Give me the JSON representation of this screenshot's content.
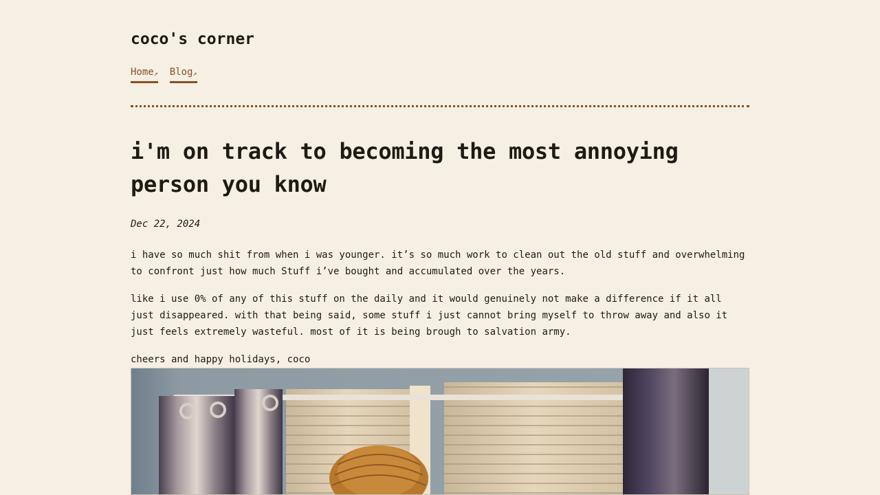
{
  "site": {
    "title": "coco's corner"
  },
  "nav": {
    "items": [
      {
        "label": "Home",
        "arrow": "↗"
      },
      {
        "label": "Blog",
        "arrow": "↗"
      }
    ]
  },
  "post": {
    "title": "i'm on track to becoming the most annoying person you know",
    "date": "Dec 22, 2024",
    "paragraphs": [
      "i have so much shit from when i was younger. it’s so much work to clean out the old stuff and overwhelming to confront just how much Stuff i’ve bought and accumulated over the years.",
      "like i use 0% of any of this stuff on the daily and it would genuinely not make a difference if it all just disappeared. with that being said, some stuff i just cannot bring myself to throw away and also it just feels extremely wasteful. most of it is being brough to salvation army.",
      "cheers and happy holidays, coco"
    ]
  },
  "colors": {
    "background": "#f6f0e4",
    "text": "#1f1a14",
    "accent": "#8a4f23"
  }
}
